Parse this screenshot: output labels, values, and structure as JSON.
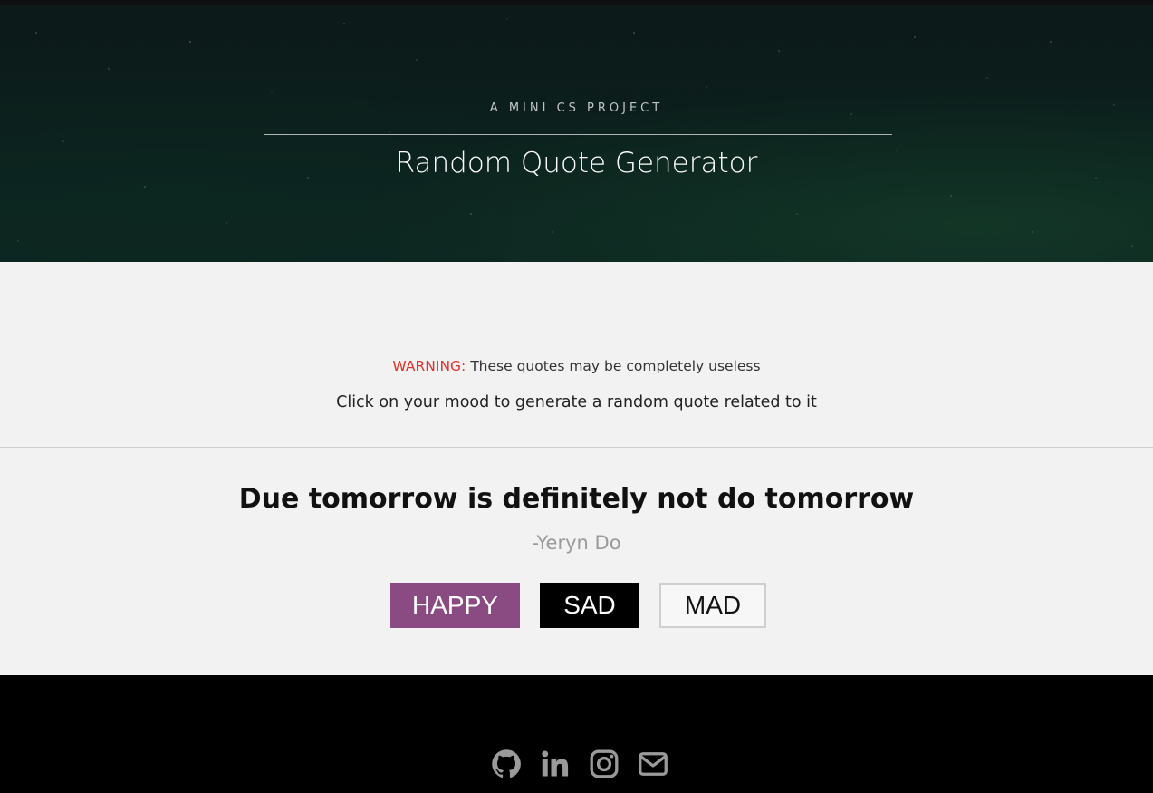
{
  "header": {
    "kicker": "A MINI CS PROJECT",
    "title": "Random Quote Generator"
  },
  "intro": {
    "warning_label": "WARNING:",
    "warning_text": " These quotes may be completely useless",
    "instruction": "Click on your mood to generate a random quote related to it"
  },
  "quote": {
    "text": "Due tomorrow is definitely not do tomorrow",
    "author": "-Yeryn Do"
  },
  "moods": {
    "happy": "HAPPY",
    "sad": "SAD",
    "mad": "MAD"
  },
  "footer": {
    "icons": [
      "github-icon",
      "linkedin-icon",
      "instagram-icon",
      "envelope-icon"
    ]
  },
  "colors": {
    "happy": "#8a4a82",
    "sad": "#000000",
    "warning": "#e0322b",
    "author": "#9a9a9a"
  }
}
